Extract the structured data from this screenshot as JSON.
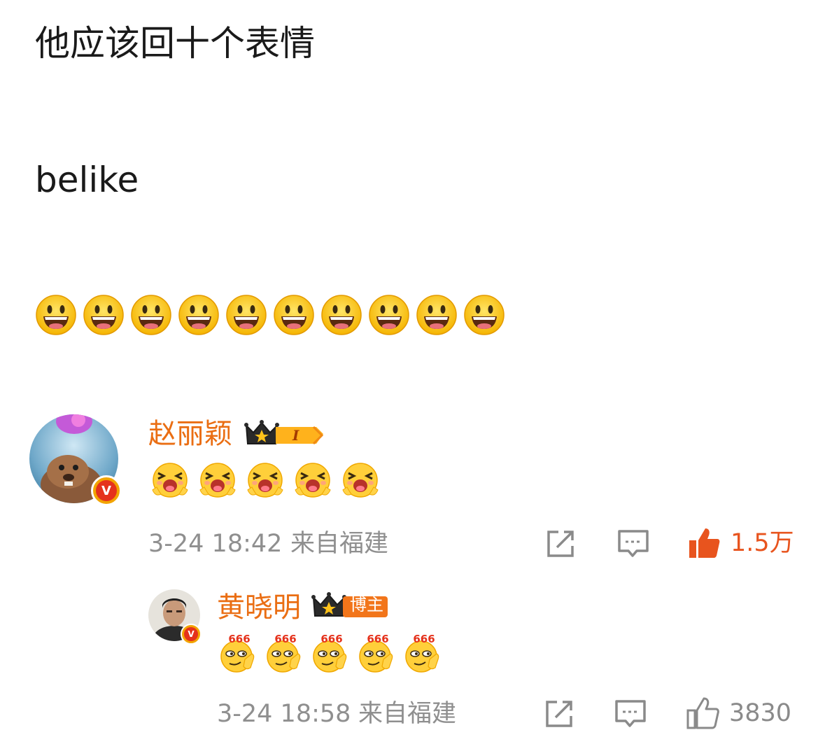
{
  "post": {
    "line1": "他应该回十个表情",
    "line2": "belike",
    "emoji_count": 10,
    "emoji_icon": "smiley-emoji"
  },
  "comment": {
    "username": "赵丽颖",
    "level_badge": "I",
    "stickers_count": 5,
    "sticker_icon": "excited-face-sticker",
    "date": "3-24 18:42",
    "location": "来自福建",
    "likes": "1.5万",
    "liked": true,
    "like_color": "#e8541e"
  },
  "reply": {
    "username": "黄晓明",
    "badge": "博主",
    "stickers_count": 5,
    "sticker_icon": "666-thumbs-sticker",
    "sticker_text": "666",
    "date": "3-24 18:58",
    "location": "来自福建",
    "likes": "3830",
    "liked": false
  },
  "colors": {
    "username": "#ea6e13",
    "meta": "#8f8f8f",
    "verified": "#e5321c"
  }
}
